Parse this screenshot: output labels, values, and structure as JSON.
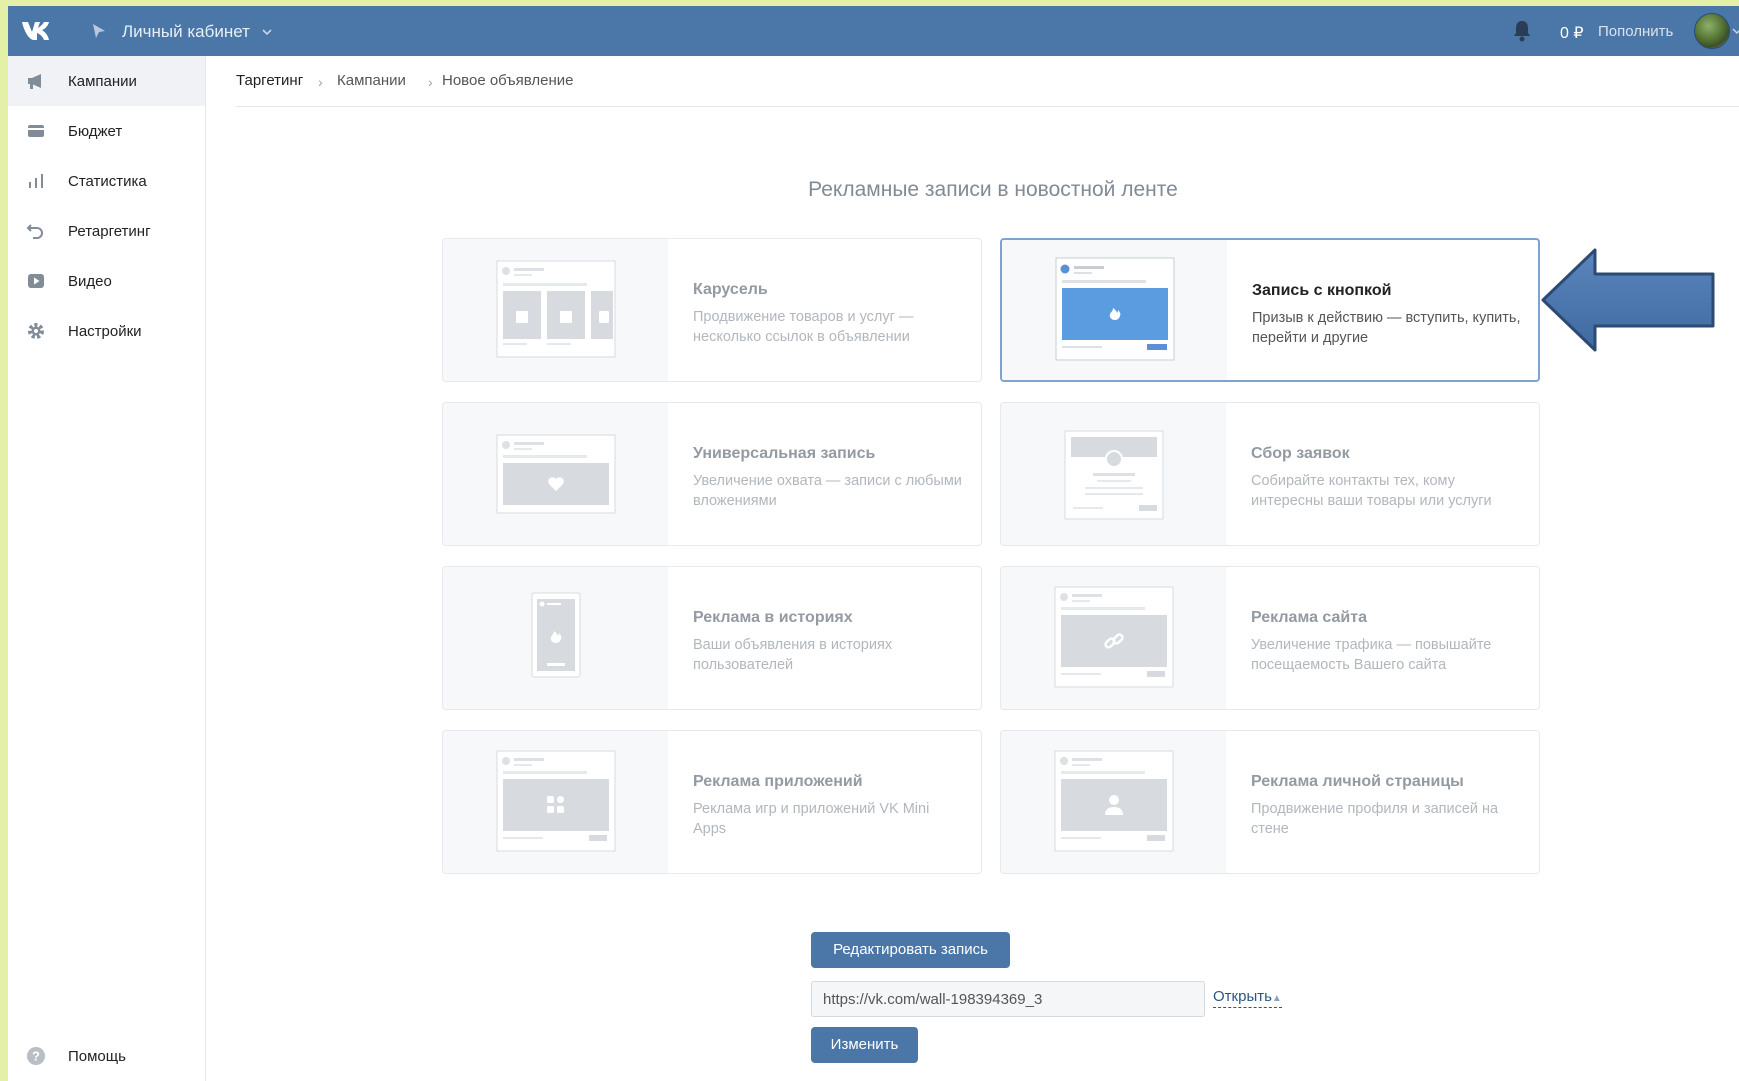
{
  "header": {
    "logo": "vk-logo",
    "cabinet_title": "Личный кабинет",
    "balance": "0 ₽",
    "topup_label": "Пополнить",
    "colors": {
      "bar": "#4a76a8"
    }
  },
  "sidebar": {
    "items": [
      {
        "label": "Кампании",
        "icon": "megaphone-icon",
        "active": true
      },
      {
        "label": "Бюджет",
        "icon": "wallet-icon"
      },
      {
        "label": "Статистика",
        "icon": "bar-chart-icon"
      },
      {
        "label": "Ретаргетинг",
        "icon": "undo-arrow-icon"
      },
      {
        "label": "Видео",
        "icon": "play-icon"
      },
      {
        "label": "Настройки",
        "icon": "gear-icon"
      }
    ],
    "help_label": "Помощь"
  },
  "breadcrumb": {
    "items": [
      "Таргетинг",
      "Кампании",
      "Новое объявление"
    ],
    "separator": "›"
  },
  "main": {
    "section_title": "Рекламные записи в новостной ленте",
    "cards": [
      {
        "title": "Карусель",
        "desc": "Продвижение товаров и услуг — несколько ссылок в объявлении",
        "icon": "carousel-preview-icon"
      },
      {
        "title": "Запись с кнопкой",
        "desc": "Призыв к действию — вступить, купить, перейти и другие",
        "icon": "button-post-preview-icon",
        "selected": true
      },
      {
        "title": "Универсальная запись",
        "desc": "Увеличение охвата — записи с любыми вложениями",
        "icon": "universal-post-preview-icon"
      },
      {
        "title": "Сбор заявок",
        "desc": "Собирайте контакты тех, кому интересны ваши товары или услуги",
        "icon": "lead-form-preview-icon"
      },
      {
        "title": "Реклама в историях",
        "desc": "Ваши объявления в историях пользователей",
        "icon": "stories-preview-icon"
      },
      {
        "title": "Реклама сайта",
        "desc": "Увеличение трафика — повышайте посещаемость Вашего сайта",
        "icon": "link-preview-icon"
      },
      {
        "title": "Реклама приложений",
        "desc": "Реклама игр и приложений VK Mini Apps",
        "icon": "apps-preview-icon"
      },
      {
        "title": "Реклама личной страницы",
        "desc": "Продвижение профиля и записей на стене",
        "icon": "profile-preview-icon"
      }
    ],
    "edit_button": "Редактировать запись",
    "url_value": "https://vk.com/wall-198394369_3",
    "open_link": "Открыть",
    "change_button": "Изменить"
  },
  "annotation": {
    "arrow_color": "#4a76a8",
    "icon": "left-arrow-annotation"
  }
}
